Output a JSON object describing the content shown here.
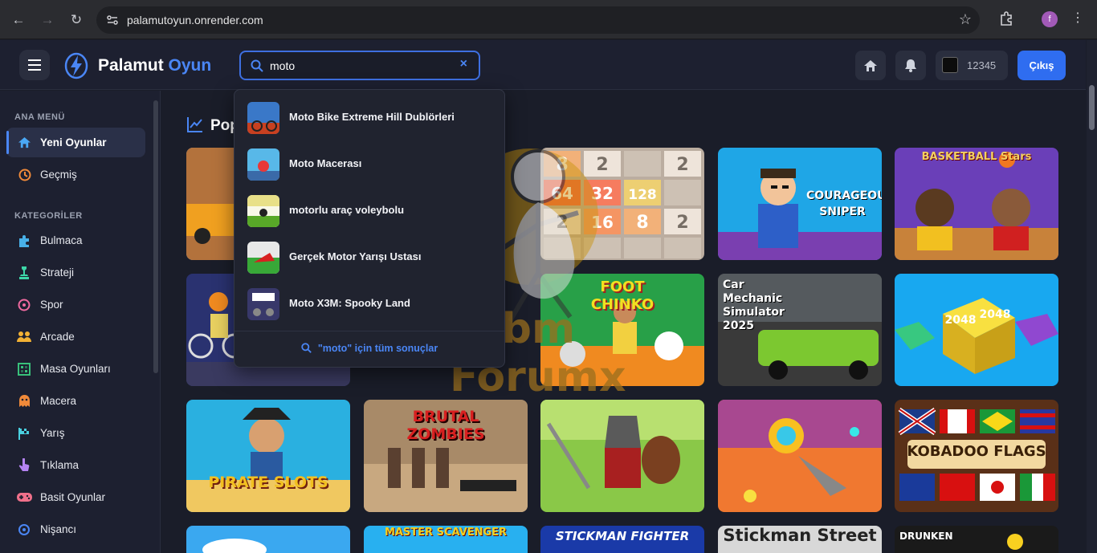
{
  "browser": {
    "url": "palamutoyun.onrender.com",
    "profile_initial": "f"
  },
  "header": {
    "logo_main": "Palamut",
    "logo_accent": "Oyun",
    "search_value": "moto",
    "coins": "12345",
    "logout_label": "Çıkış"
  },
  "sidebar": {
    "main_heading": "ANA MENÜ",
    "main_items": [
      {
        "label": "Yeni Oyunlar",
        "icon": "home-icon",
        "active": true
      },
      {
        "label": "Geçmiş",
        "icon": "history-icon"
      }
    ],
    "categories_heading": "KATEGORİLER",
    "categories": [
      {
        "label": "Bulmaca",
        "icon": "puzzle-icon"
      },
      {
        "label": "Strateji",
        "icon": "chess-icon"
      },
      {
        "label": "Spor",
        "icon": "ball-icon"
      },
      {
        "label": "Arcade",
        "icon": "users-icon"
      },
      {
        "label": "Masa Oyunları",
        "icon": "board-icon"
      },
      {
        "label": "Macera",
        "icon": "ghost-icon"
      },
      {
        "label": "Yarış",
        "icon": "flag-icon"
      },
      {
        "label": "Tıklama",
        "icon": "pointer-icon"
      },
      {
        "label": "Basit Oyunlar",
        "icon": "gamepad-icon"
      },
      {
        "label": "Nişancı",
        "icon": "crosshair-icon"
      }
    ]
  },
  "main": {
    "section_title": "Pop"
  },
  "dropdown": {
    "results": [
      {
        "label": "Moto Bike Extreme Hill Dublörleri"
      },
      {
        "label": "Moto Macerası"
      },
      {
        "label": "motorlu araç voleybolu"
      },
      {
        "label": "Gerçek Motor Yarışı Ustası"
      },
      {
        "label": "Moto X3M: Spooky Land"
      }
    ],
    "all_results": "\"moto\" için tüm sonuçlar"
  },
  "cards": {
    "courageous": "COURAGEOUS SNIPER",
    "basketball": "BASKETBALL Stars",
    "foot": "FOOT CHINKO",
    "car": "Car Mechanic Simulator 2025",
    "pirate": "PIRATE SLOTS",
    "brutal": "BRUTAL ZOMBIES",
    "kobadoo": "KOBADOO FLAGS",
    "master": "MASTER SCAVENGER",
    "stickman_fighter": "STICKMAN FIGHTER",
    "stickman_street": "Stickman Street",
    "drunken": "DRUNKEN"
  },
  "watermark": {
    "line1": "Webm",
    "line2": "Forumx"
  }
}
